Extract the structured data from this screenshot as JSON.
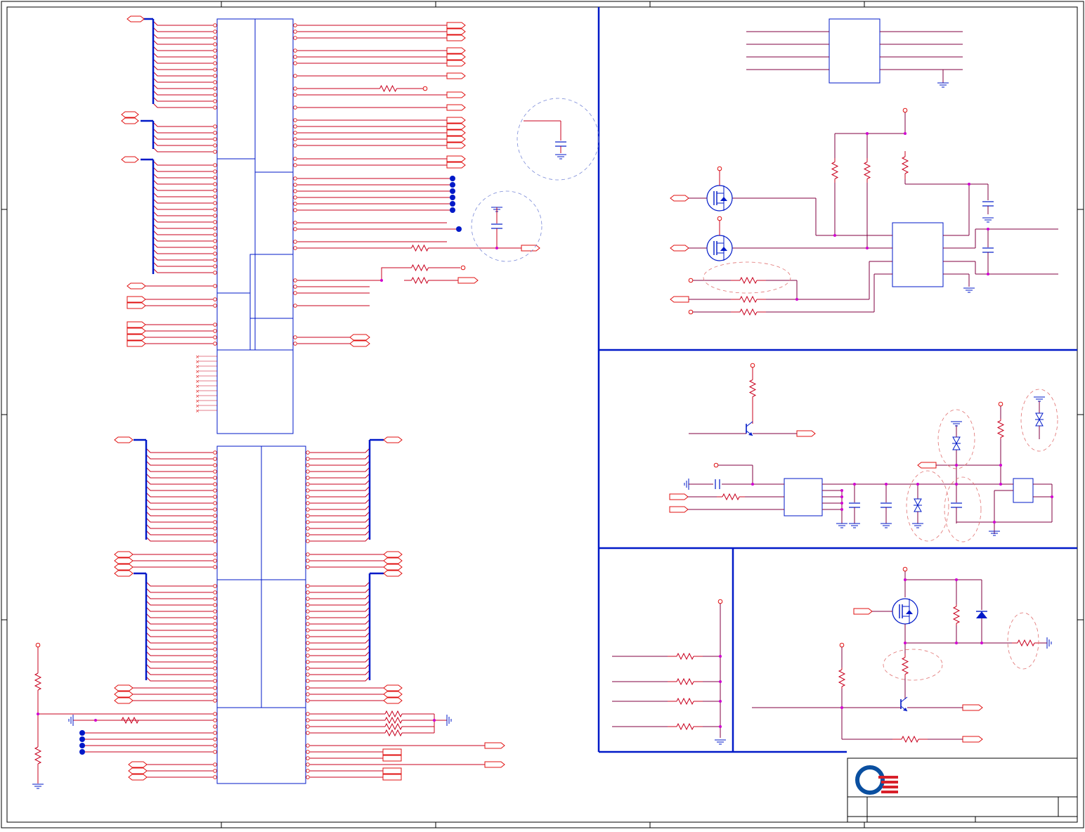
{
  "sheet": {
    "paper_color": "#ffffff",
    "frame_color": "#000000"
  },
  "colors": {
    "net": "#c8001e",
    "bus": "#0019c8",
    "symbol": "#0019c8",
    "port": "#e01010",
    "junction": "#d000d0",
    "highlight_circle": "#7a8ad8",
    "highlight_circle_red": "#e05050",
    "wire_alt": "#800040"
  },
  "icons": {
    "logo": "company-logo-icon",
    "ground": "ground-icon",
    "resistor": "resistor-icon",
    "capacitor": "capacitor-icon",
    "mosfet": "mosfet-icon",
    "transistor": "transistor-icon",
    "diode": "diode-icon",
    "tvs": "tvs-diode-icon",
    "port": "port-flag-icon"
  },
  "logo": {
    "ring_color": "#0a4fa0",
    "stripe_color": "#d8202a"
  }
}
